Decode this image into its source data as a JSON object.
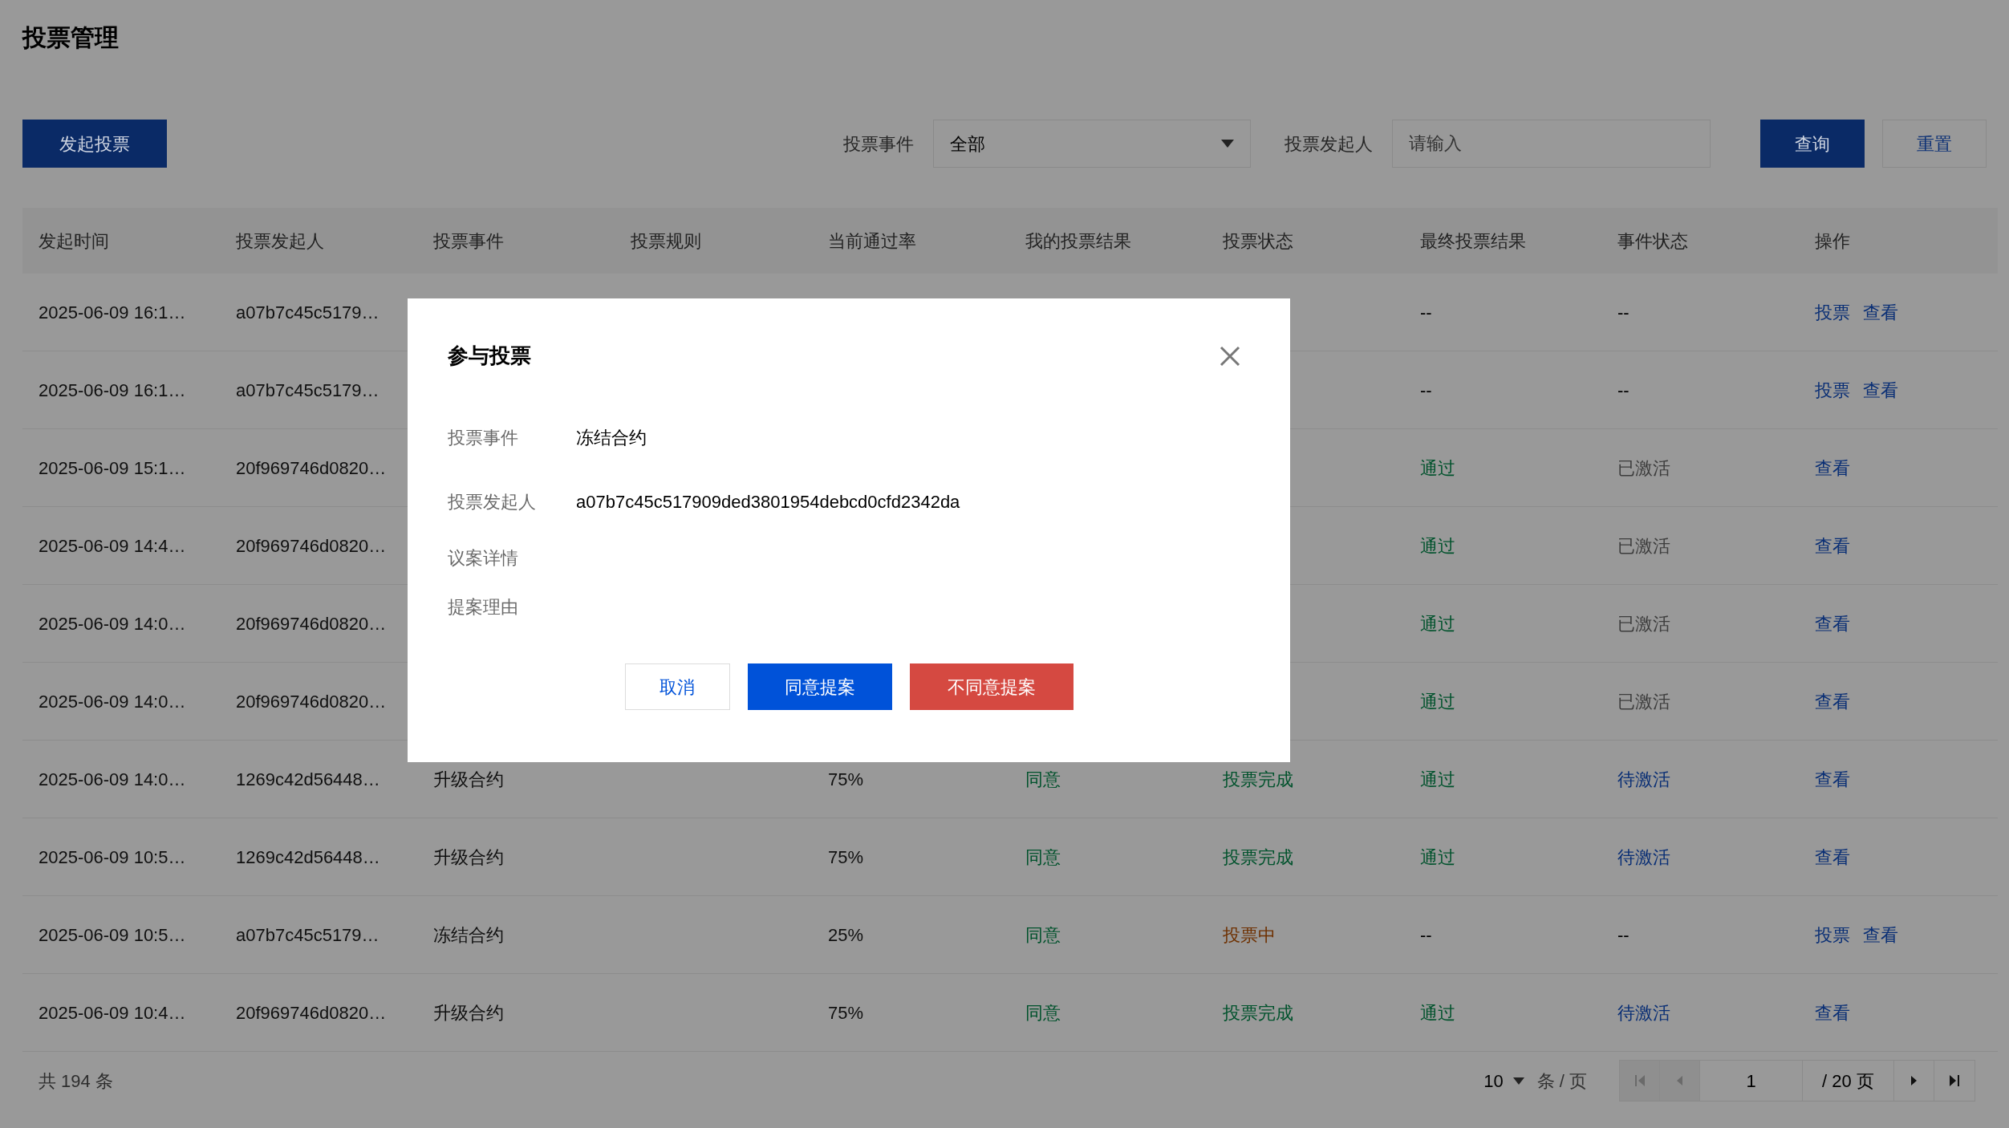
{
  "title": "投票管理",
  "toolbar": {
    "create_button": "发起投票",
    "filters": [
      {
        "kind": "select",
        "label": "投票事件",
        "value": "全部"
      },
      {
        "kind": "input",
        "label": "投票发起人",
        "placeholder": "请输入"
      }
    ],
    "buttons": [
      {
        "kind": "primary",
        "label": "查询"
      },
      {
        "kind": "outline",
        "label": "重置"
      }
    ]
  },
  "table": {
    "columns": [
      "发起时间",
      "投票发起人",
      "投票事件",
      "投票规则",
      "当前通过率",
      "我的投票结果",
      "投票状态",
      "最终投票结果",
      "事件状态",
      "操作"
    ],
    "rows": [
      {
        "start_time": "2025-06-09 16:1…",
        "initiator": "a07b7c45c5179…",
        "final_result": {
          "text": "--",
          "color": "#000000"
        },
        "event_status": {
          "text": "--",
          "color": "#000000"
        },
        "actions": [
          "投票",
          "查看"
        ]
      },
      {
        "start_time": "2025-06-09 16:1…",
        "initiator": "a07b7c45c5179…",
        "final_result": {
          "text": "--",
          "color": "#000000"
        },
        "event_status": {
          "text": "--",
          "color": "#000000"
        },
        "actions": [
          "投票",
          "查看"
        ]
      },
      {
        "start_time": "2025-06-09 15:1…",
        "initiator": "20f969746d0820…",
        "final_result": {
          "text": "通过",
          "color": "#00522c"
        },
        "event_status": {
          "text": "已激活",
          "color": "#3d3d3d"
        },
        "actions": [
          "查看"
        ]
      },
      {
        "start_time": "2025-06-09 14:4…",
        "initiator": "20f969746d0820…",
        "final_result": {
          "text": "通过",
          "color": "#00522c"
        },
        "event_status": {
          "text": "已激活",
          "color": "#3d3d3d"
        },
        "actions": [
          "查看"
        ]
      },
      {
        "start_time": "2025-06-09 14:0…",
        "initiator": "20f969746d0820…",
        "final_result": {
          "text": "通过",
          "color": "#00522c"
        },
        "event_status": {
          "text": "已激活",
          "color": "#3d3d3d"
        },
        "actions": [
          "查看"
        ]
      },
      {
        "start_time": "2025-06-09 14:0…",
        "initiator": "20f969746d0820…",
        "final_result": {
          "text": "通过",
          "color": "#00522c"
        },
        "event_status": {
          "text": "已激活",
          "color": "#3d3d3d"
        },
        "actions": [
          "查看"
        ]
      },
      {
        "start_time": "2025-06-09 14:0…",
        "initiator": "1269c42d56448…",
        "event": "升级合约",
        "rate": "75%",
        "my_result": {
          "text": "同意",
          "color": "#00522c"
        },
        "vote_status": {
          "text": "投票完成",
          "color": "#00522c"
        },
        "final_result": {
          "text": "通过",
          "color": "#00522c"
        },
        "event_status": {
          "text": "待激活",
          "color": "#0a2f75"
        },
        "actions": [
          "查看"
        ]
      },
      {
        "start_time": "2025-06-09 10:5…",
        "initiator": "1269c42d56448…",
        "event": "升级合约",
        "rate": "75%",
        "my_result": {
          "text": "同意",
          "color": "#00522c"
        },
        "vote_status": {
          "text": "投票完成",
          "color": "#00522c"
        },
        "final_result": {
          "text": "通过",
          "color": "#00522c"
        },
        "event_status": {
          "text": "待激活",
          "color": "#0a2f75"
        },
        "actions": [
          "查看"
        ]
      },
      {
        "start_time": "2025-06-09 10:5…",
        "initiator": "a07b7c45c5179…",
        "event": "冻结合约",
        "rate": "25%",
        "my_result": {
          "text": "同意",
          "color": "#00522c"
        },
        "vote_status": {
          "text": "投票中",
          "color": "#6e3000"
        },
        "final_result": {
          "text": "--",
          "color": "#000000"
        },
        "event_status": {
          "text": "--",
          "color": "#000000"
        },
        "actions": [
          "投票",
          "查看"
        ]
      },
      {
        "start_time": "2025-06-09 10:4…",
        "initiator": "20f969746d0820…",
        "event": "升级合约",
        "rate": "75%",
        "my_result": {
          "text": "同意",
          "color": "#00522c"
        },
        "vote_status": {
          "text": "投票完成",
          "color": "#00522c"
        },
        "final_result": {
          "text": "通过",
          "color": "#00522c"
        },
        "event_status": {
          "text": "待激活",
          "color": "#0a2f75"
        },
        "actions": [
          "查看"
        ]
      }
    ]
  },
  "pagination": {
    "total": "共 194 条",
    "page_size": "10",
    "page_size_unit": "条 / 页",
    "page": "1",
    "page_count": "/ 20 页",
    "first_disabled": true,
    "prev_disabled": true
  },
  "dialog": {
    "title": "参与投票",
    "fields": [
      {
        "label": "投票事件",
        "value": "冻结合约"
      },
      {
        "label": "投票发起人",
        "value": "a07b7c45c517909ded3801954debcd0cfd2342da"
      },
      {
        "label": "议案详情"
      },
      {
        "label": "提案理由"
      }
    ],
    "buttons": [
      {
        "kind": "cancel",
        "label": "取消"
      },
      {
        "kind": "approve",
        "label": "同意提案"
      },
      {
        "kind": "reject",
        "label": "不同意提案"
      }
    ]
  }
}
